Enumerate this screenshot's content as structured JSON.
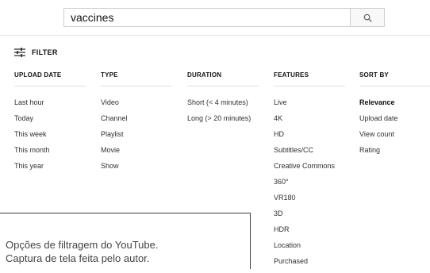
{
  "search": {
    "query": "vaccines"
  },
  "filter": {
    "label": "FILTER"
  },
  "columns": {
    "upload_date": {
      "header": "UPLOAD DATE",
      "options": [
        "Last hour",
        "Today",
        "This week",
        "This month",
        "This year"
      ]
    },
    "type": {
      "header": "TYPE",
      "options": [
        "Video",
        "Channel",
        "Playlist",
        "Movie",
        "Show"
      ]
    },
    "duration": {
      "header": "DURATION",
      "options": [
        "Short (< 4 minutes)",
        "Long (> 20 minutes)"
      ]
    },
    "features": {
      "header": "FEATURES",
      "options": [
        "Live",
        "4K",
        "HD",
        "Subtitles/CC",
        "Creative Commons",
        "360°",
        "VR180",
        "3D",
        "HDR",
        "Location",
        "Purchased"
      ]
    },
    "sort_by": {
      "header": "SORT BY",
      "options": [
        "Relevance",
        "Upload date",
        "View count",
        "Rating"
      ],
      "selected": "Relevance"
    }
  },
  "caption": {
    "line1": "Opções de filtragem do YouTube.",
    "line2": "Captura de tela feita pelo autor."
  }
}
